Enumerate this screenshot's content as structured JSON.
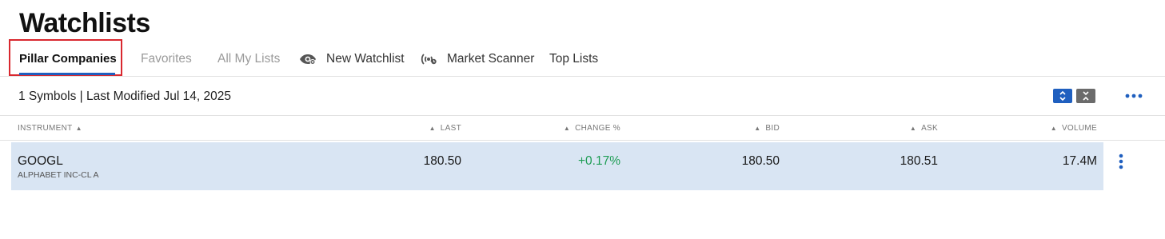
{
  "page": {
    "title": "Watchlists"
  },
  "tabs": {
    "items": [
      {
        "label": "Pillar Companies",
        "active": true
      },
      {
        "label": "Favorites",
        "active": false
      },
      {
        "label": "All My Lists",
        "active": false
      }
    ],
    "new_watchlist": {
      "label": "New Watchlist",
      "icon": "eye-icon"
    },
    "market_scanner": {
      "label": "Market Scanner",
      "icon": "broadcast-icon"
    },
    "top_lists": {
      "label": "Top Lists"
    }
  },
  "summary": {
    "text": "1 Symbols | Last Modified Jul 14, 2025"
  },
  "toolbar": {
    "expand_icon": "expand-rows-icon",
    "collapse_icon": "collapse-rows-icon",
    "more_icon": "more-horizontal-icon"
  },
  "table": {
    "columns": {
      "instrument": "INSTRUMENT",
      "last": "LAST",
      "change": "CHANGE %",
      "bid": "BID",
      "ask": "ASK",
      "volume": "VOLUME"
    },
    "rows": [
      {
        "symbol": "GOOGL",
        "name": "ALPHABET INC-CL A",
        "last": "180.50",
        "change": "+0.17%",
        "bid": "180.50",
        "ask": "180.51",
        "volume": "17.4M"
      }
    ]
  },
  "colors": {
    "accent": "#1f5fbf",
    "positive": "#1f9d55",
    "row_highlight": "#d9e5f3",
    "focus_outline": "#d9282f"
  }
}
